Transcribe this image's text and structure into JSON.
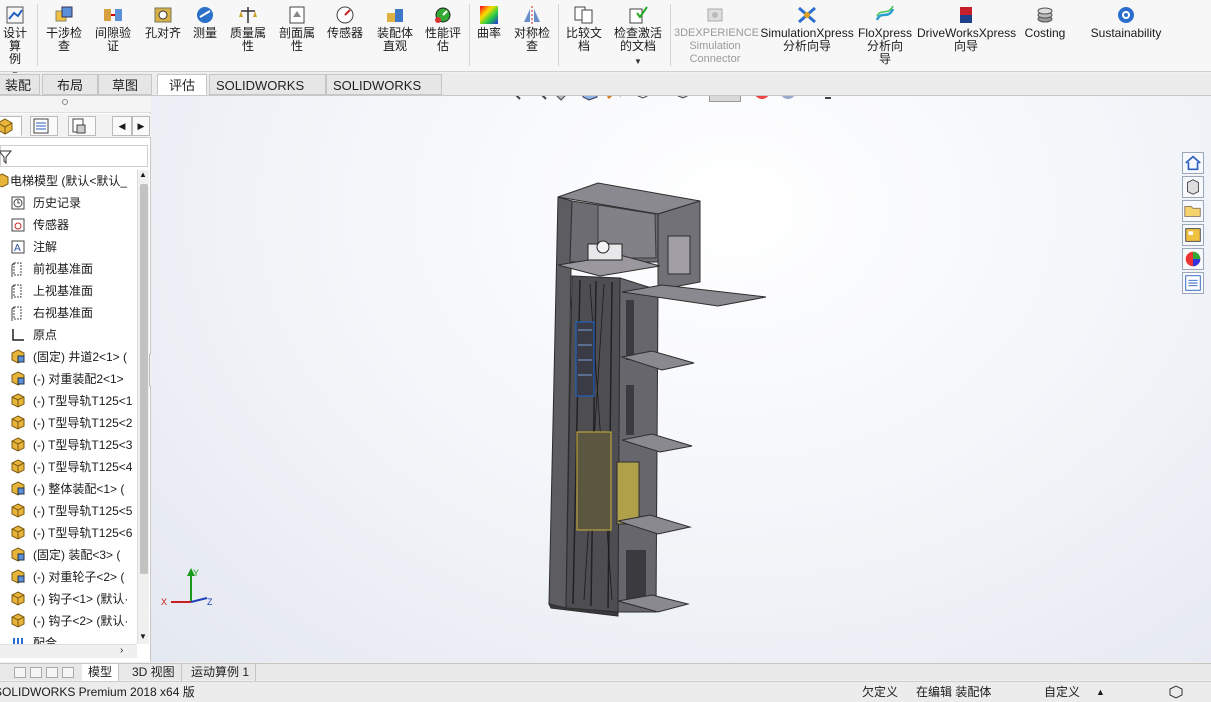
{
  "ribbon": {
    "buttons": [
      {
        "label": "设计算\n例",
        "icon": "design-study-icon"
      },
      {
        "label": "干涉检\n查",
        "icon": "interference-check-icon"
      },
      {
        "label": "间隙验\n证",
        "icon": "clearance-verification-icon"
      },
      {
        "label": "孔对齐",
        "icon": "hole-alignment-icon"
      },
      {
        "label": "测量",
        "icon": "measure-icon"
      },
      {
        "label": "质量属\n性",
        "icon": "mass-properties-icon"
      },
      {
        "label": "剖面属\n性",
        "icon": "section-properties-icon"
      },
      {
        "label": "传感器",
        "icon": "sensor-icon"
      },
      {
        "label": "装配体\n直观",
        "icon": "assemblyxpert-icon"
      },
      {
        "label": "性能评\n估",
        "icon": "performance-evaluation-icon"
      },
      {
        "label": "曲率",
        "icon": "curvature-icon"
      },
      {
        "label": "对称检\n查",
        "icon": "symmetry-check-icon"
      },
      {
        "label": "比较文\n档",
        "icon": "compare-documents-icon"
      },
      {
        "label": "检查激活\n的文档",
        "icon": "check-active-document-icon"
      },
      {
        "label": "3DEXPERIENCE\nSimulation\nConnector",
        "icon": "3dexperience-icon",
        "disabled": true
      },
      {
        "label": "SimulationXpress\n分析向导",
        "icon": "simulationxpress-icon"
      },
      {
        "label": "FloXpress\n分析向\n导",
        "icon": "floxpress-icon"
      },
      {
        "label": "DriveWorksXpress\n向导",
        "icon": "driveworksxpress-icon"
      },
      {
        "label": "Costing",
        "icon": "costing-icon"
      },
      {
        "label": "Sustainability",
        "icon": "sustainability-icon"
      }
    ]
  },
  "command_tabs": [
    "装配体",
    "布局",
    "草图",
    "评估",
    "SOLIDWORKS 插件",
    "SOLIDWORKS MBD"
  ],
  "active_command_tab": "评估",
  "feature_tree": {
    "root": "电梯模型 (默认<默认_",
    "items": [
      {
        "label": "历史记录",
        "icon": "history-icon"
      },
      {
        "label": "传感器",
        "icon": "sensor-folder-icon"
      },
      {
        "label": "注解",
        "icon": "annotation-icon"
      },
      {
        "label": "前视基准面",
        "icon": "plane-icon"
      },
      {
        "label": "上视基准面",
        "icon": "plane-icon"
      },
      {
        "label": "右视基准面",
        "icon": "plane-icon"
      },
      {
        "label": "原点",
        "icon": "origin-icon"
      },
      {
        "label": "(固定) 井道2<1> (",
        "icon": "assembly-icon"
      },
      {
        "label": "(-) 对重装配2<1>",
        "icon": "assembly-icon"
      },
      {
        "label": "(-) T型导轨T125<1",
        "icon": "part-icon"
      },
      {
        "label": "(-) T型导轨T125<2",
        "icon": "part-icon"
      },
      {
        "label": "(-) T型导轨T125<3",
        "icon": "part-icon"
      },
      {
        "label": "(-) T型导轨T125<4",
        "icon": "part-icon"
      },
      {
        "label": "(-) 整体装配<1> (",
        "icon": "assembly-icon"
      },
      {
        "label": "(-) T型导轨T125<5",
        "icon": "part-icon"
      },
      {
        "label": "(-) T型导轨T125<6",
        "icon": "part-icon"
      },
      {
        "label": "(固定) 装配<3> (",
        "icon": "assembly-icon"
      },
      {
        "label": "(-) 对重轮子<2> (",
        "icon": "assembly-icon"
      },
      {
        "label": "(-) 钩子<1> (默认·",
        "icon": "part-icon"
      },
      {
        "label": "(-) 钩子<2> (默认·",
        "icon": "part-icon"
      },
      {
        "label": "配合",
        "icon": "mates-icon"
      }
    ]
  },
  "bottom_tabs": [
    "模型",
    "3D 视图",
    "运动算例 1"
  ],
  "active_bottom_tab": "模型",
  "status": {
    "product": "SOLIDWORKS Premium 2018 x64 版",
    "definition": "欠定义",
    "mode": "在编辑 装配体",
    "units": "自定义"
  },
  "colors": {
    "model_gray": "#6e6c73",
    "model_top": "#8b8990",
    "accent_blue": "#1f5fbf",
    "highlight_yellow": "#b9a23d"
  }
}
